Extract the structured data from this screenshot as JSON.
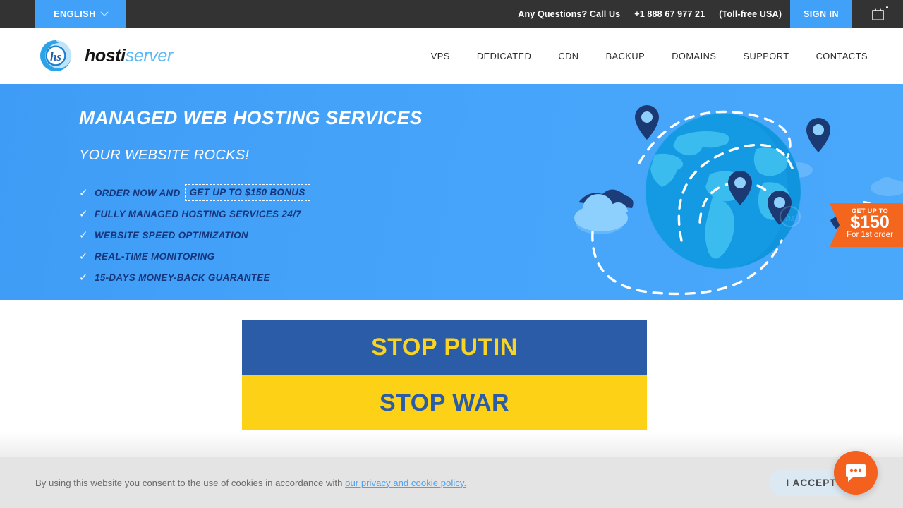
{
  "topbar": {
    "language": "ENGLISH",
    "language_icon": "chevron-down-icon",
    "questions_label": "Any Questions? Call Us",
    "phone": "+1 888 67 977 21",
    "tollfree": "(Toll-free USA)",
    "signin_label": "SIGN IN",
    "cart_icon": "shopping-bag-icon",
    "bg_color": "#333333",
    "accent_color": "#41a1f8"
  },
  "header": {
    "logo_mark": "hs",
    "logo_name_dark": "hosti",
    "logo_name_light": "server",
    "nav": [
      {
        "label": "VPS"
      },
      {
        "label": "DEDICATED"
      },
      {
        "label": "CDN"
      },
      {
        "label": "BACKUP"
      },
      {
        "label": "DOMAINS"
      },
      {
        "label": "SUPPORT"
      },
      {
        "label": "CONTACTS"
      }
    ]
  },
  "hero": {
    "title": "MANAGED WEB HOSTING SERVICES",
    "subtitle": "YOUR WEBSITE ROCKS!",
    "bg_color": "#42a0f8",
    "features": [
      {
        "text": "ORDER NOW AND",
        "link": "GET UP TO $150 BONUS",
        "check": "check-icon"
      },
      {
        "text": "FULLY MANAGED HOSTING SERVICES 24/7",
        "check": "check-icon"
      },
      {
        "text": "WEBSITE SPEED OPTIMIZATION",
        "check": "check-icon"
      },
      {
        "text": "REAL-TIME MONITORING",
        "check": "check-icon"
      },
      {
        "text": "15-DAYS MONEY-BACK GUARANTEE",
        "check": "check-icon"
      }
    ],
    "illustration": "globe-with-location-pins-and-satellite",
    "watermark": "hs",
    "ribbon": {
      "line1": "GET UP TO",
      "amount": "$150",
      "line3": "For 1st order",
      "color": "#f4661e"
    }
  },
  "banner": {
    "line1": "STOP PUTIN",
    "line2": "STOP WAR",
    "blue": "#2a5ca8",
    "yellow": "#fcd116"
  },
  "cookie": {
    "text": "By using this website you consent to the use of cookies in accordance with ",
    "link": "our privacy and cookie policy.",
    "accept_label": "I ACCEPT",
    "chat_icon": "chat-bubble-icon",
    "chat_color": "#f4601e"
  }
}
